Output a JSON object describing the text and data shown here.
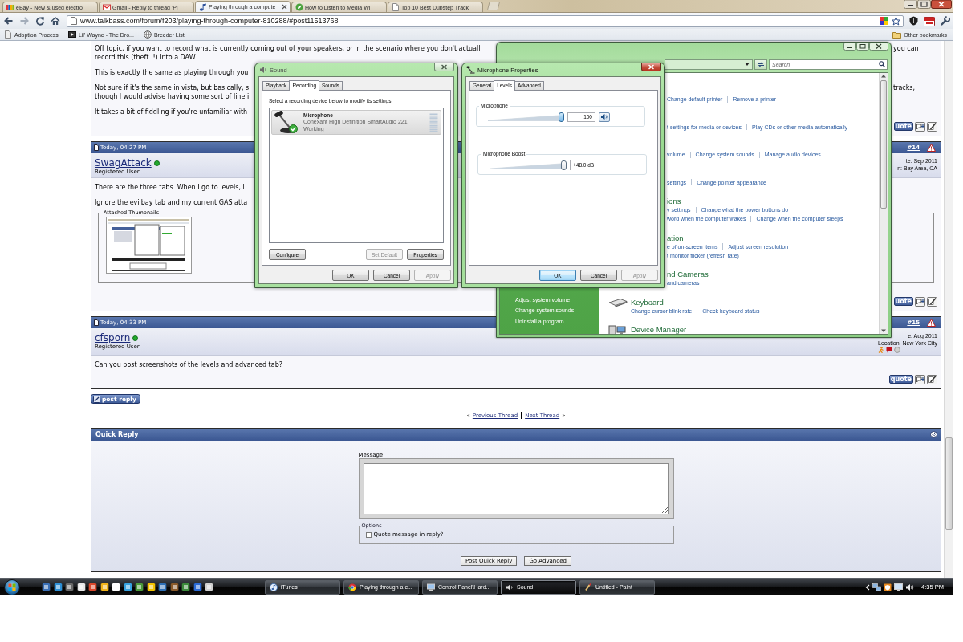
{
  "browser": {
    "tabs": [
      {
        "title": "eBay - New & used electro",
        "selected": false
      },
      {
        "title": "Gmail - Reply to thread 'Pl",
        "selected": false
      },
      {
        "title": "Playing through a compute",
        "selected": true
      },
      {
        "title": "How to Listen to Media Wi",
        "selected": false
      },
      {
        "title": "Top 10 Best Dubstep Track",
        "selected": false
      }
    ],
    "url": "www.talkbass.com/forum/f203/playing-through-computer-810288/#post11513768",
    "bookmarks": [
      "Adoption Process",
      "Lil' Wayne - The Dro...",
      "Breeder List"
    ],
    "other_bookmarks": "Other bookmarks"
  },
  "forum": {
    "posts": [
      {
        "kind": "continued",
        "paragraphs": [
          [
            {
              "text": "Off topic, if you want to record what is currently coming out of your speakers, or in the scenario where you don't actuall",
              "tail": "you can"
            },
            {
              "text": "record this (theft..!) into a DAW."
            }
          ],
          [
            {
              "text": "This is exactly the same as playing through you"
            }
          ],
          [
            {
              "text": "Not sure if it's the same in vista, but basically, s",
              "tail": "tracks,"
            },
            {
              "text": "though I would advise having some sort of line i"
            }
          ],
          [
            {
              "text": "It takes a bit of fiddling if you're unfamiliar with"
            }
          ]
        ],
        "quote_button": "uote"
      },
      {
        "kind": "full",
        "date": "Today, 04:27 PM",
        "number": "#14",
        "username": "SwagAttack",
        "online": true,
        "rank": "Registered User",
        "info": [
          "te: Sep 2011",
          "n: Bay Area, CA"
        ],
        "contact_icons": false,
        "paragraphs": [
          [
            {
              "text": "There are the three tabs. When I go to levels, i"
            }
          ],
          [
            {
              "text": "Ignore the evilbay tab and my current GAS atta"
            }
          ]
        ],
        "attachments": {
          "legend": "Attached Thumbnails"
        },
        "quote_button": "uote"
      },
      {
        "kind": "full",
        "date": "Today, 04:33 PM",
        "number": "#15",
        "username": "cfsporn",
        "online": true,
        "rank": "Registered User",
        "info": [
          "e: Aug 2011",
          "Location: New York City"
        ],
        "contact_icons": true,
        "paragraphs": [
          [
            {
              "text": "Can you post screenshots of the levels and advanced tab?"
            }
          ]
        ],
        "quote_button": "quote"
      }
    ],
    "post_reply": "post reply",
    "thread_nav": {
      "before": "«",
      "previous": "Previous Thread",
      "next": "Next Thread",
      "after": "»"
    },
    "quick_reply": {
      "title": "Quick Reply",
      "message_label": "Message:",
      "options_legend": "Options",
      "options": [
        {
          "label": "Quote message in reply?",
          "checked": false
        }
      ],
      "buttons": [
        "Post Quick Reply",
        "Go Advanced"
      ]
    }
  },
  "control_panel": {
    "search": {
      "placeholder": "Search"
    },
    "sidebar_links": [
      "Adjust system volume",
      "Change system sounds",
      "Uninstall a program"
    ],
    "sections": [
      {
        "kind": "partial",
        "link_rows": [
          [
            "Change default printer",
            "Remove a printer"
          ]
        ]
      },
      {
        "kind": "partial",
        "link_rows": [
          [
            "t settings for media or devices",
            "Play CDs or other media automatically"
          ]
        ]
      },
      {
        "kind": "partial",
        "link_rows": [
          [
            "volume",
            "Change system sounds",
            "Manage audio devices"
          ]
        ]
      },
      {
        "kind": "partial",
        "link_rows": [
          [
            "settings",
            "Change pointer appearance"
          ]
        ]
      },
      {
        "kind": "partial",
        "heading": "ions",
        "link_rows": [
          [
            "y settings",
            "Change what the power buttons do"
          ],
          [
            "word when the computer wakes",
            "Change when the computer sleeps"
          ]
        ]
      },
      {
        "kind": "partial",
        "heading": "ation",
        "link_rows": [
          [
            "e of on-screen items",
            "Adjust screen resolution"
          ],
          [
            "t monitor flicker (refresh rate)"
          ]
        ]
      },
      {
        "kind": "partial",
        "heading": "nd Cameras",
        "link_rows": [
          [
            "and cameras"
          ]
        ]
      },
      {
        "kind": "full",
        "heading": "Keyboard",
        "link_rows": [
          [
            "Change cursor blink rate",
            "Check keyboard status"
          ]
        ]
      },
      {
        "kind": "full",
        "heading": "Device Manager"
      }
    ]
  },
  "sound_window": {
    "title": "Sound",
    "active": false,
    "tabs": [
      {
        "label": "Playback",
        "selected": false
      },
      {
        "label": "Recording",
        "selected": true
      },
      {
        "label": "Sounds",
        "selected": false
      }
    ],
    "instruction": "Select a recording device below to modify its settings:",
    "devices": [
      {
        "name": "Microphone",
        "driver": "Conexant High Definition SmartAudio 221",
        "status": "Working",
        "selected": true,
        "default": true,
        "level": 0
      }
    ],
    "buttons": [
      {
        "label": "Configure",
        "disabled": false
      },
      {
        "label": "Set Default",
        "disabled": true
      },
      {
        "label": "Properties",
        "disabled": false
      }
    ],
    "dialog_buttons": [
      {
        "label": "OK",
        "default": false,
        "disabled": false
      },
      {
        "label": "Cancel",
        "default": false,
        "disabled": false
      },
      {
        "label": "Apply",
        "default": false,
        "disabled": true
      }
    ]
  },
  "mic_properties": {
    "title": "Microphone Properties",
    "active": true,
    "tabs": [
      {
        "label": "General",
        "selected": false
      },
      {
        "label": "Levels",
        "selected": true
      },
      {
        "label": "Advanced",
        "selected": false
      }
    ],
    "controls": [
      {
        "kind": "volume",
        "label": "Microphone",
        "level": 1,
        "focused": true,
        "reading": "100",
        "muted": false
      },
      {
        "kind": "boost",
        "label": "Microphone Boost",
        "level": 1,
        "focused": false,
        "reading": "+48.0 dB"
      }
    ],
    "dialog_buttons": [
      {
        "label": "OK",
        "default": true,
        "disabled": false
      },
      {
        "label": "Cancel",
        "default": false,
        "disabled": false
      },
      {
        "label": "Apply",
        "default": false,
        "disabled": true
      }
    ]
  },
  "taskbar": {
    "tasks": [
      {
        "label": "iTunes",
        "selected": false
      },
      {
        "label": "Playing through a c...",
        "selected": false
      },
      {
        "label": "Control Panel\\Hard...",
        "selected": false
      },
      {
        "label": "Sound",
        "selected": true
      },
      {
        "label": "Untitled - Paint",
        "selected": false
      }
    ],
    "clock": "4:35 PM"
  }
}
